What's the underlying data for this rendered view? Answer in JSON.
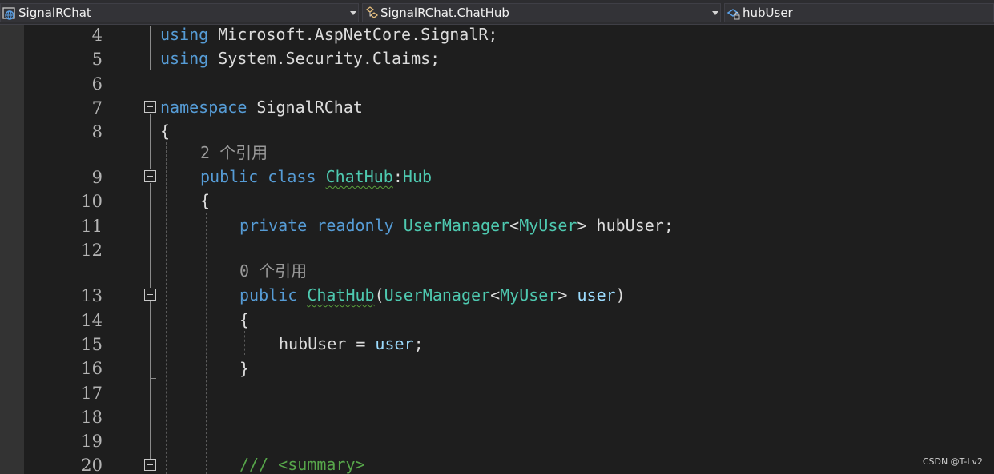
{
  "navigation_bar": {
    "project_combo": {
      "label": "SignalRChat",
      "icon": "csharp-project-icon"
    },
    "type_combo": {
      "label": "SignalRChat.ChatHub",
      "icon": "class-icon"
    },
    "member_combo": {
      "label": "hubUser",
      "icon": "private-field-icon"
    }
  },
  "line_numbers": [
    "4",
    "5",
    "6",
    "7",
    "8",
    "9",
    "10",
    "11",
    "12",
    "13",
    "14",
    "15",
    "16",
    "17",
    "18",
    "19",
    "20"
  ],
  "code": {
    "line4": {
      "kw": "using",
      "rest": " Microsoft.AspNetCore.SignalR;"
    },
    "line5": {
      "kw": "using",
      "rest": " System.Security.Claims;"
    },
    "line7": {
      "kw": "namespace",
      "rest": " SignalRChat"
    },
    "line8": {
      "text": "{"
    },
    "codelens_class": "2 个引用",
    "line9": {
      "kw1": "public",
      "kw2": "class",
      "name": "ChatHub",
      "colon": ":",
      "base": "Hub"
    },
    "line10": {
      "text": "{"
    },
    "line11": {
      "kw1": "private",
      "kw2": "readonly",
      "type1": "UserManager",
      "lt": "<",
      "type2": "MyUser",
      "gt": ">",
      "rest": " hubUser;"
    },
    "codelens_ctor": "0 个引用",
    "line13": {
      "kw": "public",
      "name": "ChatHub",
      "open": "(",
      "type1": "UserManager",
      "lt": "<",
      "type2": "MyUser",
      "gt": ">",
      "param": "user",
      "close": ")"
    },
    "line14": {
      "text": "{"
    },
    "line15": {
      "field": "hubUser",
      "op": " = ",
      "param": "user",
      "end": ";"
    },
    "line16": {
      "text": "}"
    },
    "line20": {
      "text": "/// <summary>"
    }
  },
  "watermark": "CSDN @T-Lv2",
  "colors": {
    "keyword": "#569cd6",
    "type": "#4ec9b0",
    "parameter": "#9cdcfe",
    "comment": "#57a64a",
    "text": "#dcdcdc",
    "background": "#1e1e1e"
  }
}
